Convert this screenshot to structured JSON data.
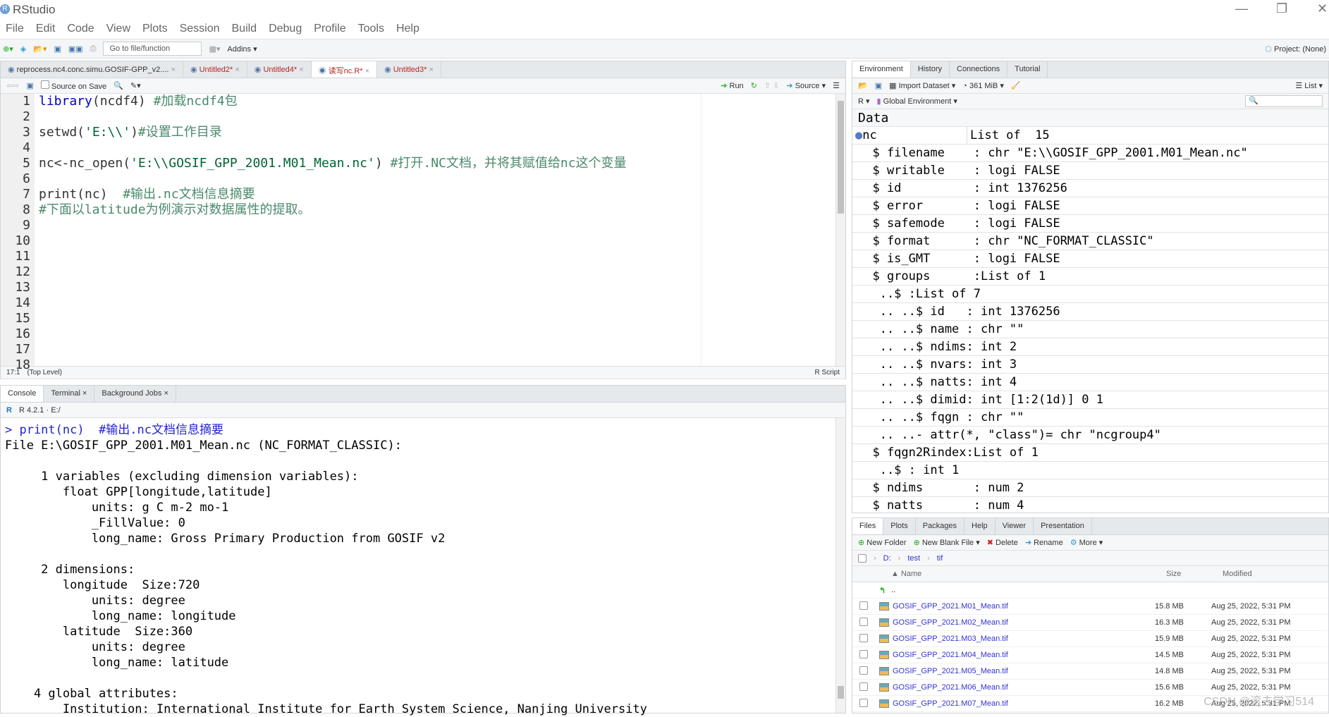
{
  "window": {
    "title": "RStudio",
    "minimize": "—",
    "restore": "❐",
    "close": "✕"
  },
  "menu": [
    "File",
    "Edit",
    "Code",
    "View",
    "Plots",
    "Session",
    "Build",
    "Debug",
    "Profile",
    "Tools",
    "Help"
  ],
  "toolbar": {
    "goto_placeholder": "Go to file/function",
    "addins": "Addins",
    "project": "Project: (None)"
  },
  "editor": {
    "tabs": [
      {
        "label": "reprocess.nc4.conc.simu.GOSIF-GPP_v2....",
        "modified": false
      },
      {
        "label": "Untitled2*",
        "modified": true
      },
      {
        "label": "Untitled4*",
        "modified": true
      },
      {
        "label": "读写nc.R*",
        "modified": true,
        "active": true
      },
      {
        "label": "Untitled3*",
        "modified": true
      }
    ],
    "source_on_save": "Source on Save",
    "run": "Run",
    "source": "Source",
    "lines": [
      {
        "n": "1",
        "code": "library",
        "rest": "(ncdf4) ",
        "cm": "#加载ncdf4包"
      },
      {
        "n": "2"
      },
      {
        "n": "3",
        "plain": "setwd(",
        "str": "'E:\\\\'",
        "rest": ")",
        "cm": "#设置工作目录"
      },
      {
        "n": "4"
      },
      {
        "n": "5",
        "plain": "nc<-nc_open(",
        "str": "'E:\\\\GOSIF_GPP_2001.M01_Mean.nc'",
        "rest": ") ",
        "cm": "#打开.NC文档，并将其赋值给nc这个变量"
      },
      {
        "n": "6"
      },
      {
        "n": "7",
        "plain": "print(nc)  ",
        "cm": "#输出.nc文档信息摘要"
      },
      {
        "n": "8",
        "cm": "#下面以latitude为例演示对数据属性的提取。"
      },
      {
        "n": "9"
      },
      {
        "n": "10"
      },
      {
        "n": "11"
      },
      {
        "n": "12"
      },
      {
        "n": "13"
      },
      {
        "n": "14"
      },
      {
        "n": "15"
      },
      {
        "n": "16"
      },
      {
        "n": "17"
      },
      {
        "n": "18"
      }
    ],
    "status": {
      "position": "17:1",
      "scope": "(Top Level)",
      "type": "R Script"
    }
  },
  "console": {
    "tabs": [
      "Console",
      "Terminal",
      "Background Jobs"
    ],
    "version": "R 4.2.1 · E:/",
    "prompt": "> print(nc)  #输出.nc文档信息摘要",
    "output": "File E:\\GOSIF_GPP_2001.M01_Mean.nc (NC_FORMAT_CLASSIC):\n\n     1 variables (excluding dimension variables):\n        float GPP[longitude,latitude]\n            units: g C m-2 mo-1\n            _FillValue: 0\n            long_name: Gross Primary Production from GOSIF v2\n\n     2 dimensions:\n        longitude  Size:720\n            units: degree\n            long_name: longitude\n        latitude  Size:360\n            units: degree\n            long_name: latitude\n\n    4 global attributes:\n        Institution: International Institute for Earth System Science, Nanjing University"
  },
  "environment": {
    "tabs": [
      "Environment",
      "History",
      "Connections",
      "Tutorial"
    ],
    "import_dataset": "Import Dataset",
    "memory": "361 MiB",
    "view": "List",
    "lang": "R",
    "scope": "Global Environment",
    "section": "Data",
    "var_name": "nc",
    "var_value": "List of  15",
    "rows": [
      "  $ filename    : chr \"E:\\\\GOSIF_GPP_2001.M01_Mean.nc\"",
      "  $ writable    : logi FALSE",
      "  $ id          : int 1376256",
      "  $ error       : logi FALSE",
      "  $ safemode    : logi FALSE",
      "  $ format      : chr \"NC_FORMAT_CLASSIC\"",
      "  $ is_GMT      : logi FALSE",
      "  $ groups      :List of 1",
      "   ..$ :List of 7",
      "   .. ..$ id   : int 1376256",
      "   .. ..$ name : chr \"\"",
      "   .. ..$ ndims: int 2",
      "   .. ..$ nvars: int 3",
      "   .. ..$ natts: int 4",
      "   .. ..$ dimid: int [1:2(1d)] 0 1",
      "   .. ..$ fqgn : chr \"\"",
      "   .. ..- attr(*, \"class\")= chr \"ncgroup4\"",
      "  $ fqgn2Rindex:List of 1",
      "   ..$ : int 1",
      "  $ ndims       : num 2",
      "  $ natts       : num 4"
    ]
  },
  "files": {
    "tabs": [
      "Files",
      "Plots",
      "Packages",
      "Help",
      "Viewer",
      "Presentation"
    ],
    "actions": {
      "new_folder": "New Folder",
      "new_blank": "New Blank File",
      "delete": "Delete",
      "rename": "Rename",
      "more": "More"
    },
    "path": [
      "D:",
      "test",
      "tif"
    ],
    "columns": {
      "name": "Name",
      "size": "Size",
      "modified": "Modified"
    },
    "up": "..",
    "items": [
      {
        "name": "GOSIF_GPP_2021.M01_Mean.tif",
        "size": "15.8 MB",
        "modified": "Aug 25, 2022, 5:31 PM"
      },
      {
        "name": "GOSIF_GPP_2021.M02_Mean.tif",
        "size": "16.3 MB",
        "modified": "Aug 25, 2022, 5:31 PM"
      },
      {
        "name": "GOSIF_GPP_2021.M03_Mean.tif",
        "size": "15.9 MB",
        "modified": "Aug 25, 2022, 5:31 PM"
      },
      {
        "name": "GOSIF_GPP_2021.M04_Mean.tif",
        "size": "14.5 MB",
        "modified": "Aug 25, 2022, 5:31 PM"
      },
      {
        "name": "GOSIF_GPP_2021.M05_Mean.tif",
        "size": "14.8 MB",
        "modified": "Aug 25, 2022, 5:31 PM"
      },
      {
        "name": "GOSIF_GPP_2021.M06_Mean.tif",
        "size": "15.6 MB",
        "modified": "Aug 25, 2022, 5:31 PM"
      },
      {
        "name": "GOSIF_GPP_2021.M07_Mean.tif",
        "size": "16.2 MB",
        "modified": "Aug 25, 2022, 5:31 PM"
      }
    ]
  },
  "watermark": "CSDN @滚去学习514"
}
